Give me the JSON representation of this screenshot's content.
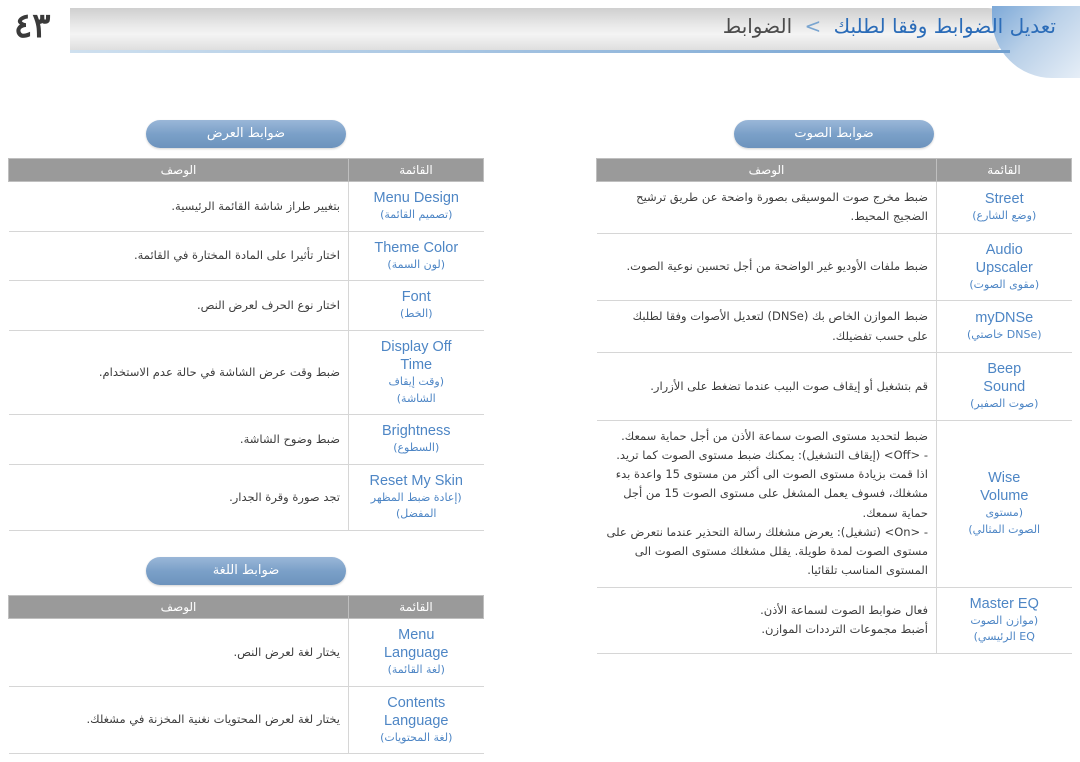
{
  "header": {
    "page_number": "٤٣",
    "title_main": "تعديل الضوابط وفقا لطلبك",
    "title_sep": ">",
    "title_tail": "الضوابط"
  },
  "right_column": {
    "pill": "ضوابط الصوت",
    "columns": {
      "item": "القائمة",
      "desc": "الوصف"
    },
    "rows": [
      {
        "en": "Street",
        "ar": "(وضع الشارع)",
        "desc": [
          "ضبط مخرج صوت الموسيقى بصورة واضحة عن طريق ترشيح",
          "الضجيج المحيط."
        ]
      },
      {
        "en": "Audio\nUpscaler",
        "ar": "(مقوى الصوت)",
        "desc": [
          "ضبط ملفات الأوديو غير الواضحة من أجل تحسين نوعية الصوت."
        ]
      },
      {
        "en": "myDNSe",
        "ar": "(DNSe خاصتي)",
        "desc": [
          "ضبط الموازن الخاص بك (DNSe) لتعديل الأصوات وفقا لطلبك",
          "على حسب تفضيلك."
        ]
      },
      {
        "en": "Beep\nSound",
        "ar": "(صوت الصفير)",
        "desc": [
          "قم بتشغيل أو إيقاف صوت البيب عندما تضغط على الأزرار."
        ]
      },
      {
        "en": "Wise\nVolume",
        "ar": "(مستوى\nالصوت المثالي)",
        "desc": [
          "ضبط لتحديد مستوى الصوت سماعة الأذن من أجل حماية سمعك.",
          "- <Off> (إيقاف التشغيل): يمكنك ضبط مستوى الصوت كما تريد.",
          "اذا قمت بزيادة مستوى الصوت الى أكثر من مستوى 15 واعدة بدء",
          "مشغلك، فسوف يعمل المشغل على مستوى الصوت 15 من أجل",
          "حماية سمعك.",
          "- <On> (تشغيل): يعرض مشغلك رسالة التحذير عندما نتعرض على",
          "مستوى الصوت لمدة طويلة. يقلل مشغلك مستوى الصوت الى",
          "المستوى المناسب تلقائيا."
        ]
      },
      {
        "en": "Master EQ",
        "ar": "(موازن الصوت\nEQ الرئيسي)",
        "desc": [
          "فعال ضوابط الصوت لسماعة الأذن.",
          "أضبط مجموعات الترددات الموازن."
        ]
      }
    ]
  },
  "left_column": {
    "pill_top": "ضوابط العرض",
    "pill_bottom": "ضوابط اللغة",
    "columns": {
      "item": "القائمة",
      "desc": "الوصف"
    },
    "rows_top": [
      {
        "en": "Menu Design",
        "ar": "(تصميم القائمة)",
        "desc": [
          "بتغيير طراز شاشة القائمة الرئيسية."
        ]
      },
      {
        "en": "Theme Color",
        "ar": "(لون السمة)",
        "desc": [
          "اختار تأثيرا على المادة المختارة في القائمة."
        ]
      },
      {
        "en": "Font",
        "ar": "(الخط)",
        "desc": [
          "اختار نوع الحرف لعرض النص."
        ]
      },
      {
        "en": "Display Off\nTime",
        "ar": "(وقت إيقاف\nالشاشة)",
        "desc": [
          "ضبط وقت عرض الشاشة في حالة عدم الاستخدام."
        ]
      },
      {
        "en": "Brightness",
        "ar": "(السطوع)",
        "desc": [
          "ضبط وضوح الشاشة."
        ]
      },
      {
        "en": "Reset My Skin",
        "ar": "(إعادة ضبط المظهر\nالمفضل)",
        "desc": [
          "تجد صورة وقرة الجدار."
        ]
      }
    ],
    "rows_bottom": [
      {
        "en": "Menu\nLanguage",
        "ar": "(لغة القائمة)",
        "desc": [
          "يختار لغة لعرض النص."
        ]
      },
      {
        "en": "Contents\nLanguage",
        "ar": "(لغة المحتويات)",
        "desc": [
          "يختار لغة لعرض المحتويات نغنية المخزنة في مشغلك."
        ]
      }
    ]
  }
}
